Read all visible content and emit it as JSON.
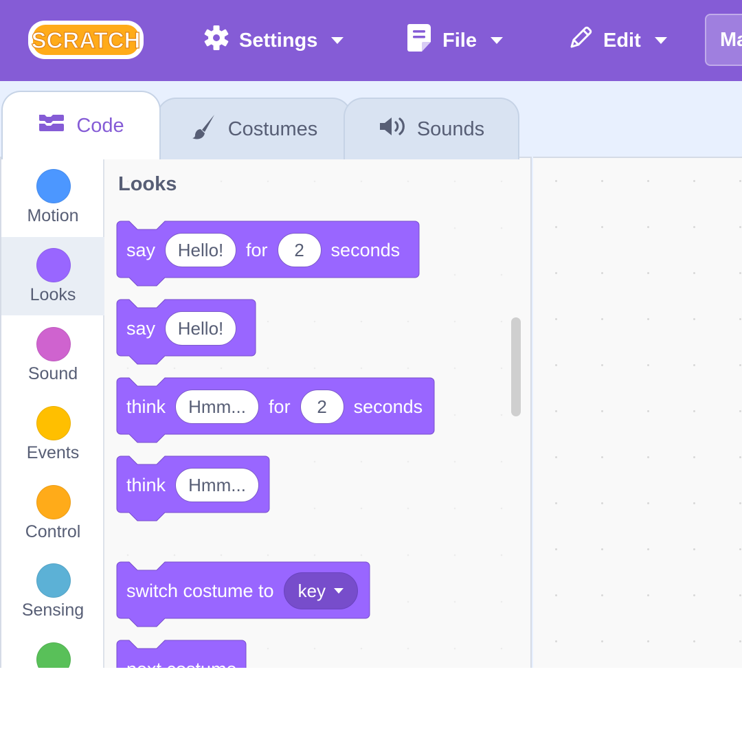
{
  "menubar": {
    "logo_text": "SCRATCH",
    "settings_label": "Settings",
    "file_label": "File",
    "edit_label": "Edit",
    "cut_off_label": "Ma"
  },
  "tabs": {
    "code": "Code",
    "costumes": "Costumes",
    "sounds": "Sounds",
    "selected": "Code"
  },
  "categories": [
    {
      "label": "Motion",
      "color": "#4c97ff"
    },
    {
      "label": "Looks",
      "color": "#9966ff"
    },
    {
      "label": "Sound",
      "color": "#cf63cf"
    },
    {
      "label": "Events",
      "color": "#ffbf00"
    },
    {
      "label": "Control",
      "color": "#ffab19"
    },
    {
      "label": "Sensing",
      "color": "#5cb1d6"
    },
    {
      "label": "",
      "color": "#59c059"
    }
  ],
  "selected_category": "Looks",
  "palette": {
    "title": "Looks",
    "block_color": "#9966ff",
    "blocks": [
      {
        "kind": "say-for",
        "word": "say",
        "message": "Hello!",
        "for_text": "for",
        "secs": "2",
        "unit": "seconds"
      },
      {
        "kind": "say",
        "word": "say",
        "message": "Hello!"
      },
      {
        "kind": "think-for",
        "word": "think",
        "message": "Hmm...",
        "for_text": "for",
        "secs": "2",
        "unit": "seconds"
      },
      {
        "kind": "think",
        "word": "think",
        "message": "Hmm..."
      },
      {
        "kind": "switch-costume",
        "text": "switch costume to",
        "value": "key"
      },
      {
        "kind": "next-costume",
        "text": "next costume"
      }
    ]
  }
}
